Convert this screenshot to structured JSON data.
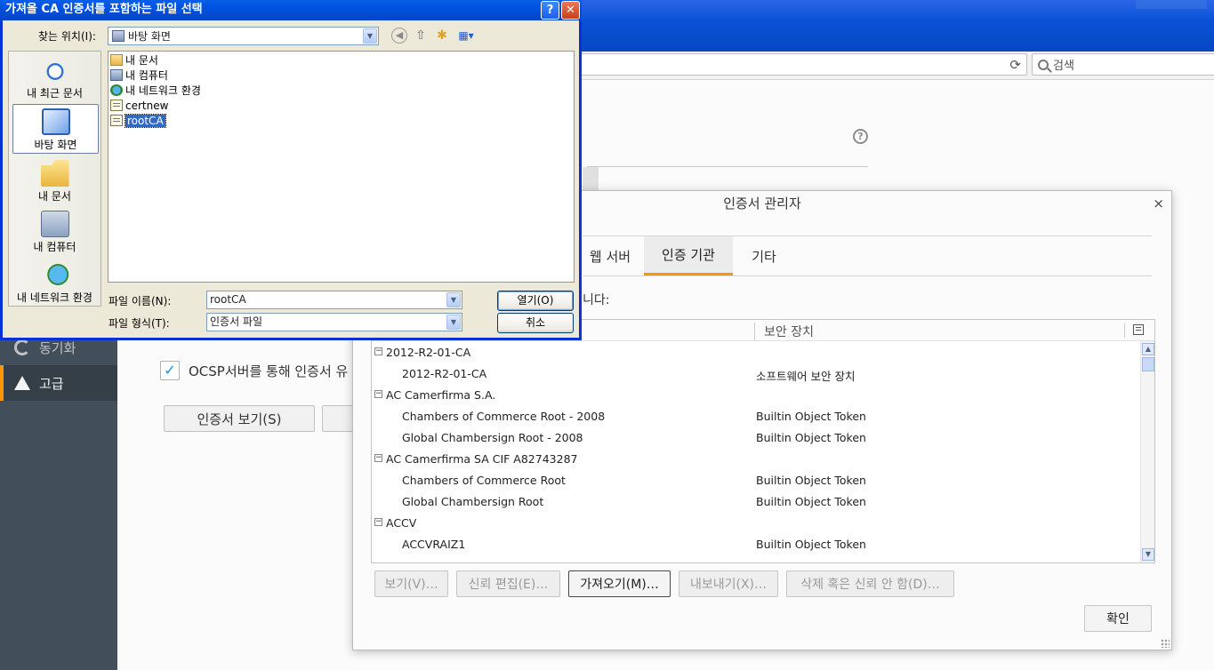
{
  "browser": {
    "search_placeholder": "검색"
  },
  "preferences": {
    "sidebar": [
      {
        "label": "동기화",
        "icon": "sync-icon"
      },
      {
        "label": "고급",
        "icon": "advanced-icon"
      }
    ],
    "ocsp_label": "OCSP서버를 통해 인증서 유",
    "ocsp_checked": true,
    "view_certs_button": "인증서 보기(S)"
  },
  "cert_manager": {
    "title": "인증서 관리자",
    "close": "×",
    "tabs": [
      "웹 서버",
      "인증 기관",
      "기타"
    ],
    "active_tab": "인증 기관",
    "description": "니다:",
    "col_security_device": "보안 장치",
    "rows": [
      {
        "type": "group",
        "name": "2012-R2-01-CA",
        "device": ""
      },
      {
        "type": "child",
        "name": "2012-R2-01-CA",
        "device": "소프트웨어 보안 장치"
      },
      {
        "type": "group",
        "name": "AC Camerfirma S.A.",
        "device": ""
      },
      {
        "type": "child",
        "name": "Chambers of Commerce Root - 2008",
        "device": "Builtin Object Token"
      },
      {
        "type": "child",
        "name": "Global Chambersign Root - 2008",
        "device": "Builtin Object Token"
      },
      {
        "type": "group",
        "name": "AC Camerfirma SA CIF A82743287",
        "device": ""
      },
      {
        "type": "child",
        "name": "Chambers of Commerce Root",
        "device": "Builtin Object Token"
      },
      {
        "type": "child",
        "name": "Global Chambersign Root",
        "device": "Builtin Object Token"
      },
      {
        "type": "group",
        "name": "ACCV",
        "device": ""
      },
      {
        "type": "child",
        "name": "ACCVRAIZ1",
        "device": "Builtin Object Token"
      }
    ],
    "buttons": {
      "view": "보기(V)…",
      "trust": "신뢰 편집(E)…",
      "import": "가져오기(M)…",
      "export": "내보내기(X)…",
      "delete": "삭제 혹은 신뢰 안 함(D)…",
      "ok": "확인"
    }
  },
  "file_dialog": {
    "title": "가져올 CA 인증서를 포함하는 파일 선택",
    "help": "?",
    "close": "✕",
    "lookin_label": "찾는 위치(I):",
    "lookin_value": "바탕 화면",
    "places": [
      {
        "label": "내 최근 문서",
        "icon": "recent-documents-icon"
      },
      {
        "label": "바탕 화면",
        "icon": "desktop-icon"
      },
      {
        "label": "내 문서",
        "icon": "my-documents-icon"
      },
      {
        "label": "내 컴퓨터",
        "icon": "my-computer-icon"
      },
      {
        "label": "내 네트워크 환경",
        "icon": "network-icon"
      }
    ],
    "files": [
      {
        "name": "내 문서",
        "icon": "folder-icon"
      },
      {
        "name": "내 컴퓨터",
        "icon": "computer-icon"
      },
      {
        "name": "내 네트워크 환경",
        "icon": "network-icon"
      },
      {
        "name": "certnew",
        "icon": "certificate-file-icon"
      },
      {
        "name": "rootCA",
        "icon": "certificate-file-icon"
      }
    ],
    "selected_file": "rootCA",
    "filename_label": "파일 이름(N):",
    "filename_value": "rootCA",
    "filetype_label": "파일 형식(T):",
    "filetype_value": "인증서 파일",
    "open_button": "열기(O)",
    "cancel_button": "취소"
  }
}
